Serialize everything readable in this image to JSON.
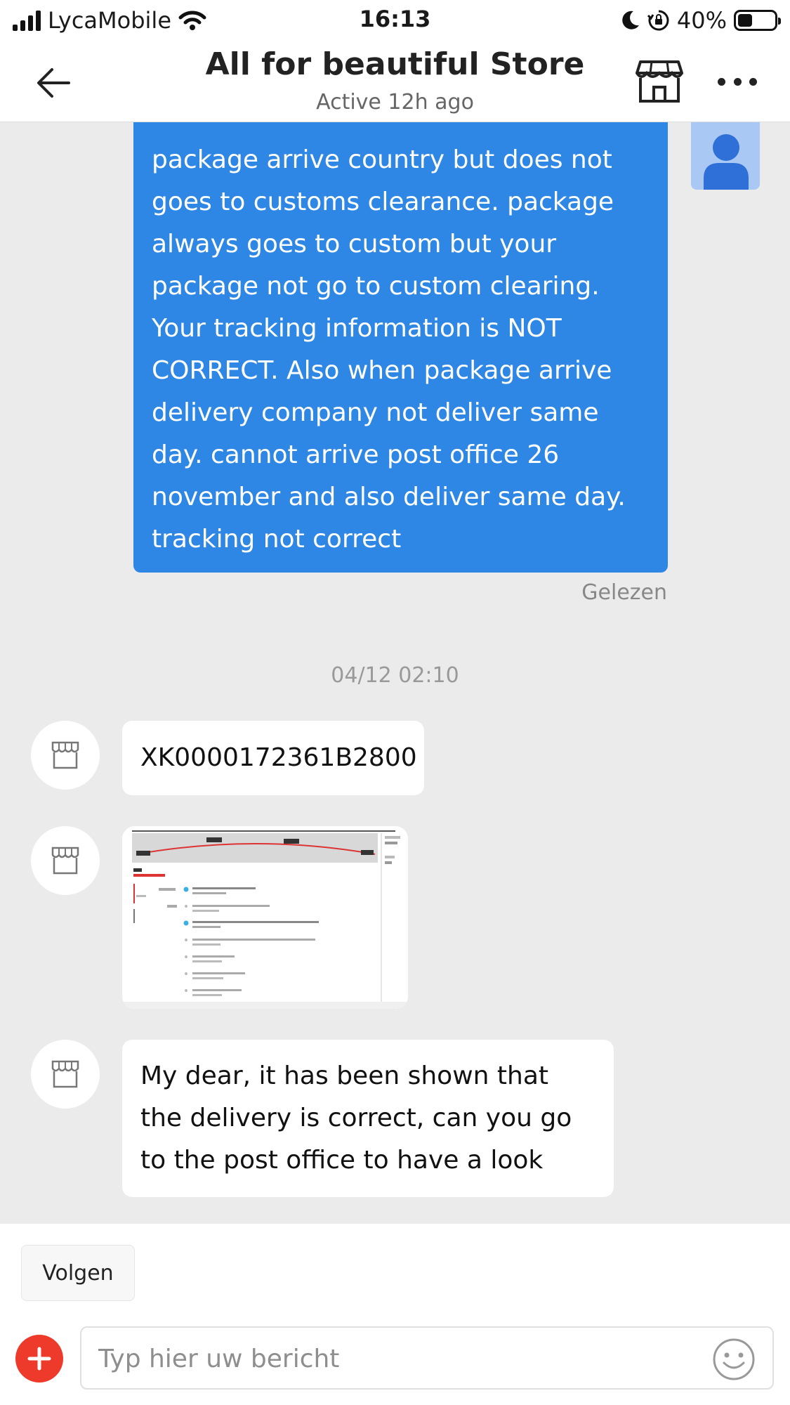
{
  "status_bar": {
    "carrier": "LycaMobile",
    "time": "16:13",
    "battery": "40%",
    "battery_level": 0.4
  },
  "header": {
    "title": "All for beautiful Store",
    "subtitle": "Active 12h ago"
  },
  "chat": {
    "outgoing_message": "package arrive country but does not goes to customs clearance. package always goes to custom but your package not go to custom clearing. Your tracking information is NOT CORRECT. Also when package arrive delivery company not deliver same day. cannot arrive post office 26 november and also deliver same day. tracking not correct",
    "read_status": "Gelezen",
    "timestamp": "04/12 02:10",
    "tracking_message": "XK0000172361B2800",
    "reply_message": "My dear, it has been shown that the delivery is correct, can you go to the post office to have a look"
  },
  "bottom": {
    "follow_label": "Volgen",
    "input_placeholder": "Typ hier uw bericht"
  },
  "icons": {
    "back": "arrow-left-icon",
    "store": "store-icon",
    "more": "more-dots-icon",
    "add": "plus-icon",
    "emoji": "smiley-icon",
    "user": "user-icon",
    "wifi": "wifi-icon",
    "moon": "moon-icon",
    "orientation_lock": "orientation-lock-icon",
    "battery": "battery-icon",
    "signal": "signal-icon"
  },
  "colors": {
    "outgoing_bubble": "#2e87e4",
    "chat_background": "#ebebeb",
    "add_button": "#ee3a2a",
    "user_avatar": "#a9c8f4",
    "user_avatar_figure": "#2e6fd8"
  }
}
